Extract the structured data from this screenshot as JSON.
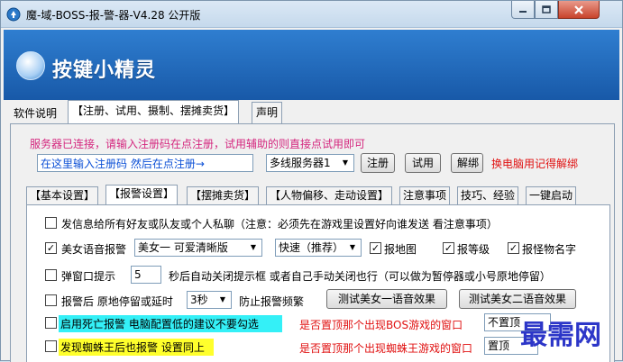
{
  "window": {
    "title": "魔-域-BOSS-报-警-器-V4.28 公开版"
  },
  "banner": {
    "logo_text": "按键小精灵"
  },
  "main_tabs": [
    "软件说明",
    "【注册、试用、摄制、摆摊卖货】",
    "声明"
  ],
  "registration": {
    "status": "服务器已连接，请输入注册码在点注册，试用辅助的则直接点试用即可",
    "code_value": "在这里输入注册码 然后在点注册→",
    "server": "多线服务器1",
    "register_label": "注册",
    "trial_label": "试用",
    "unbind_label": "解绑",
    "note": "换电脑用记得解绑"
  },
  "sub_tabs": [
    "【基本设置】",
    "【报警设置】",
    "【摆摊卖货】",
    "【人物偏移、走动设置】",
    "注意事项",
    "技巧、经验",
    "一键启动"
  ],
  "settings": {
    "row1": {
      "checked": false,
      "label": "发信息给所有好友或队友或个人私聊（注意：必须先在游戏里设置好向谁发送 看注意事项）"
    },
    "row2": {
      "checked": true,
      "label": "美女语音报警",
      "voice": "美女一 可爱清晰版",
      "speed": "快速（推荐）",
      "map_checked": true,
      "map_label": "报地图",
      "level_checked": true,
      "level_label": "报等级",
      "name_checked": true,
      "name_label": "报怪物名字"
    },
    "row3": {
      "checked": false,
      "label": "弹窗口提示",
      "seconds": "5",
      "suffix": "秒后自动关闭提示框 或者自己手动关闭也行（可以做为暂停器或小号原地停留）"
    },
    "row4": {
      "checked": false,
      "label": "报警后 原地停留或延时",
      "delay": "3秒",
      "suffix": "防止报警频繁",
      "test1_label": "测试美女一语音效果",
      "test2_label": "测试美女二语音效果"
    },
    "row5": {
      "checked": false,
      "label": "启用死亡报警 电脑配置低的建议不要勾选",
      "question": "是否置顶那个出现BOS游戏的窗口",
      "option": "不置顶"
    },
    "row6": {
      "checked": false,
      "label": "发现蜘蛛王后也报警 设置同上",
      "question": "是否置顶那个出现蜘蛛王游戏的窗口",
      "option": "置顶"
    }
  },
  "watermark": "最需网",
  "icons": [
    "app-icon",
    "minimize-icon",
    "maximize-icon",
    "close-icon",
    "dropdown-arrow-icon",
    "check-icon",
    "logo-icon"
  ],
  "colors": {
    "banner": "#1f66b8",
    "status_text": "#d4267e",
    "red_text": "#e01010",
    "cyan_highlight": "#34f0f7",
    "yellow_highlight": "#ffff2c",
    "watermark": "#2c36c8"
  }
}
